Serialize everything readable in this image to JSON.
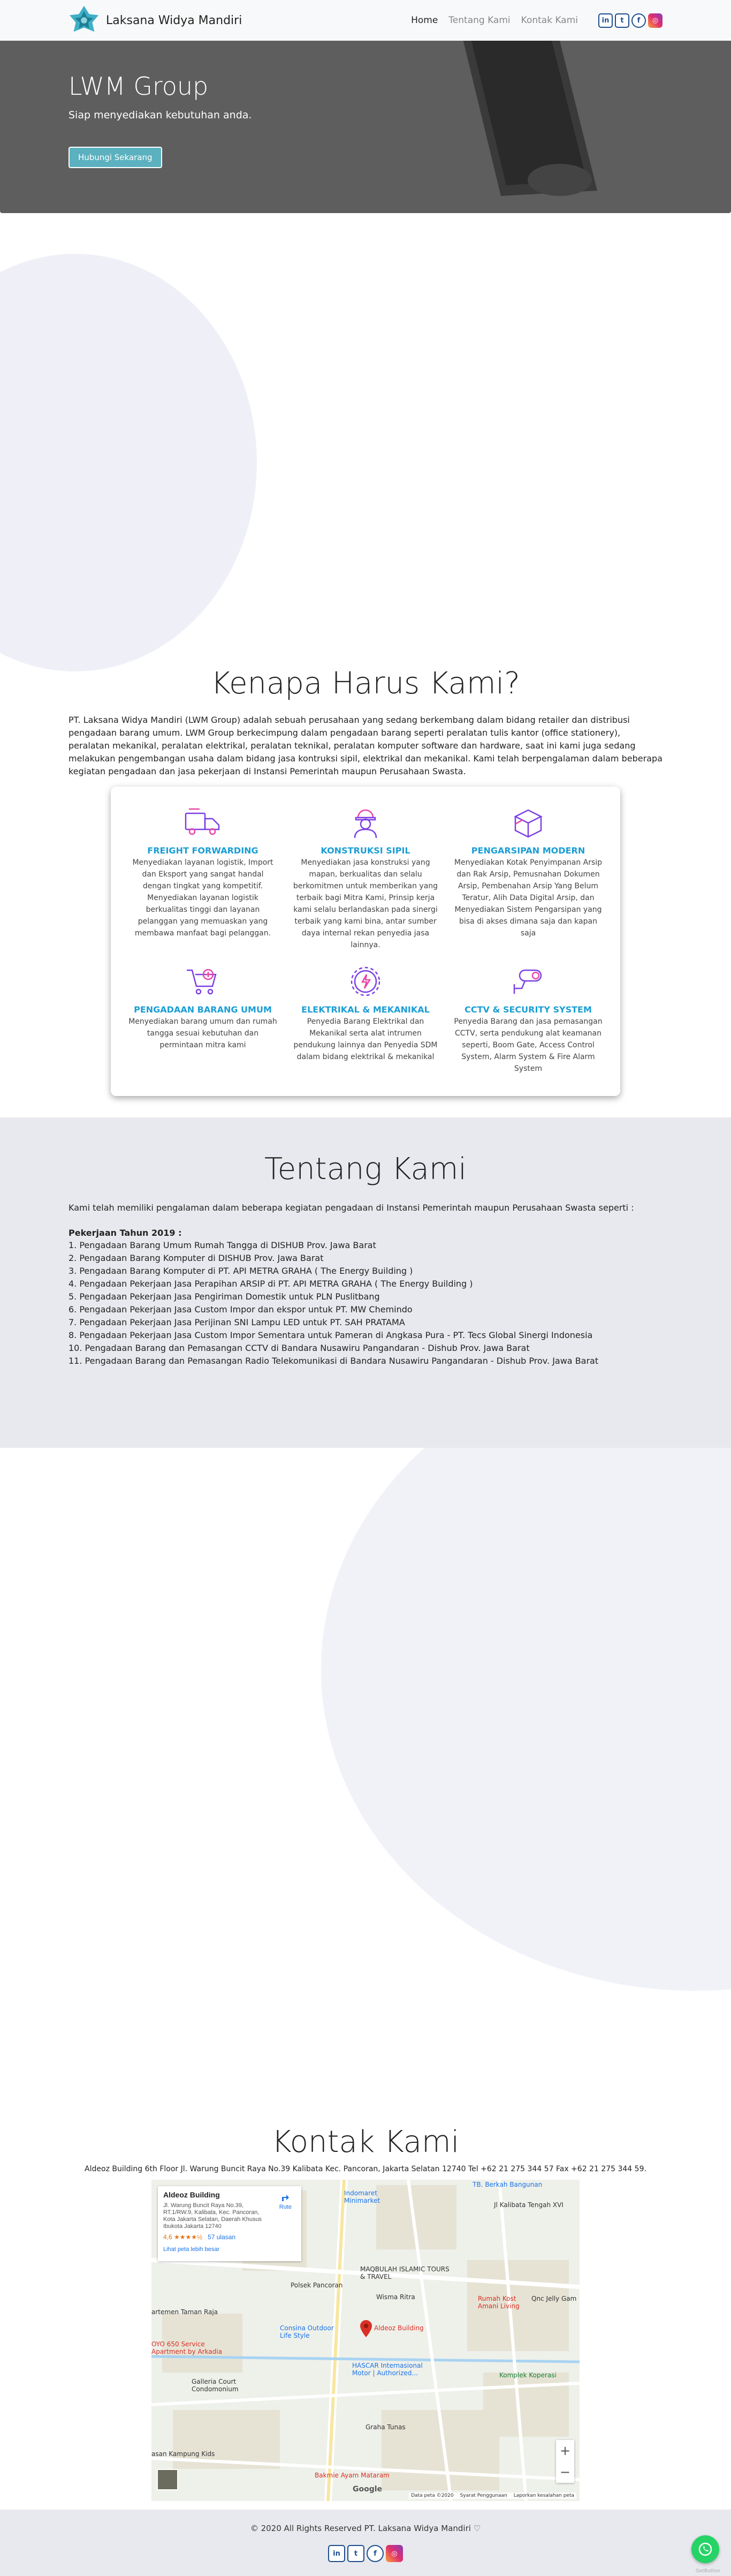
{
  "nav": {
    "brand": "Laksana Widya Mandiri",
    "links": [
      "Home",
      "Tentang Kami",
      "Kontak Kami"
    ],
    "social": [
      "linkedin-icon",
      "twitter-icon",
      "facebook-icon",
      "instagram-icon"
    ]
  },
  "hero": {
    "title": "LWM Group",
    "subtitle": "Siap menyediakan kebutuhan anda.",
    "button": "Hubungi Sekarang"
  },
  "why": {
    "title": "Kenapa Harus Kami?",
    "text": "PT. Laksana Widya Mandiri (LWM Group) adalah sebuah perusahaan yang sedang berkembang dalam bidang retailer dan distribusi pengadaan barang umum. LWM Group berkecimpung dalam pengadaan barang seperti peralatan tulis kantor (office stationery), peralatan mekanikal, peralatan elektrikal, peralatan teknikal, peralatan komputer software dan hardware, saat ini kami juga sedang melakukan pengembangan usaha dalam bidang jasa kontruksi sipil, elektrikal dan mekanikal. Kami telah berpengalaman dalam beberapa kegiatan pengadaan dan jasa pekerjaan di Instansi Pemerintah maupun Perusahaan Swasta.",
    "services": [
      {
        "title": "FREIGHT FORWARDING",
        "desc": "Menyediakan layanan logistik, Import dan Eksport yang sangat handal dengan tingkat yang kompetitif. Menyediakan layanan logistik berkualitas tinggi dan layanan pelanggan yang memuaskan yang membawa manfaat bagi pelanggan.",
        "icon": "truck-icon"
      },
      {
        "title": "KONSTRUKSI SIPIL",
        "desc": "Menyediakan jasa konstruksi yang mapan, berkualitas dan selalu berkomitmen untuk memberikan yang terbaik bagi Mitra Kami, Prinsip kerja kami selalu berlandaskan pada sinergi terbaik yang kami bina, antar sumber daya internal rekan penyedia jasa lainnya.",
        "icon": "worker-icon"
      },
      {
        "title": "PENGARSIPAN MODERN",
        "desc": "Menyediakan Kotak Penyimpanan Arsip dan Rak Arsip, Pemusnahan Dokumen Arsip, Pembenahan Arsip Yang Belum Teratur, Alih Data Digital Arsip, dan Menyediakan Sistem Pengarsipan yang bisa di akses dimana saja dan kapan saja",
        "icon": "box-icon"
      },
      {
        "title": "PENGADAAN BARANG UMUM",
        "desc": "Menyediakan barang umum dan rumah tangga sesuai kebutuhan dan permintaan mitra kami",
        "icon": "cart-icon"
      },
      {
        "title": "ELEKTRIKAL & MEKANIKAL",
        "desc": "Penyedia Barang Elektrikal dan Mekanikal serta alat intrumen pendukung lainnya dan Penyedia SDM dalam bidang elektrikal & mekanikal",
        "icon": "gear-bolt-icon"
      },
      {
        "title": "CCTV & SECURITY SYSTEM",
        "desc": "Penyedia Barang dan jasa pemasangan CCTV, serta pendukung alat keamanan seperti, Boom Gate, Access Control System, Alarm System & Fire Alarm System",
        "icon": "cctv-icon"
      }
    ]
  },
  "about": {
    "title": "Tentang Kami",
    "intro": "Kami telah memiliki pengalaman dalam beberapa kegiatan pengadaan di Instansi Pemerintah maupun Perusahaan Swasta seperti :",
    "year": "Pekerjaan Tahun 2019 :",
    "items": [
      "1. Pengadaan Barang Umum Rumah Tangga di DISHUB Prov. Jawa Barat",
      "2. Pengadaan Barang Komputer di DISHUB Prov. Jawa Barat",
      "3. Pengadaan Barang Komputer di PT. API METRA GRAHA ( The Energy Building )",
      "4. Pengadaan Pekerjaan Jasa Perapihan ARSIP di PT. API METRA GRAHA ( The Energy Building )",
      "5. Pengadaan Pekerjaan Jasa Pengiriman Domestik untuk PLN Puslitbang",
      "6. Pengadaan Pekerjaan Jasa Custom Impor dan ekspor untuk PT. MW Chemindo",
      "7. Pengadaan Pekerjaan Jasa Perijinan SNI Lampu LED untuk PT. SAH PRATAMA",
      "8. Pengadaan Pekerjaan Jasa Custom Impor Sementara untuk Pameran di Angkasa Pura - PT. Tecs Global Sinergi Indonesia",
      "10. Pengadaan Barang dan Pemasangan CCTV di Bandara Nusawiru Pangandaran - Dishub Prov. Jawa Barat",
      "11. Pengadaan Barang dan Pemasangan Radio Telekomunikasi di Bandara Nusawiru Pangandaran - Dishub Prov. Jawa Barat"
    ]
  },
  "contact": {
    "title": "Kontak Kami",
    "address": "Aldeoz Building 6th Floor Jl. Warung Buncit Raya No.39 Kalibata Kec. Pancoran, Jakarta Selatan 12740 Tel +62 21 275 344 57 Fax +62 21 275 344 59.",
    "map": {
      "place": "Aldeoz Building",
      "place_address": "Jl. Warung Buncit Raya No.39, RT.1/RW.9, Kalibata, Kec. Pancoran, Kota Jakarta Selatan, Daerah Khusus Ibukota Jakarta 12740",
      "rating": "4,6 ★★★★½",
      "reviews": "57 ulasan",
      "larger_map": "Lihat peta lebih besar",
      "route": "Rute",
      "pin_label": "Aldeoz Building",
      "footer": [
        "Data peta ©2020",
        "Syarat Penggunaan",
        "Laporkan kesalahan peta"
      ],
      "google": "Google",
      "labels": [
        {
          "text": "Indomaret Minimarket",
          "cls": "blue"
        },
        {
          "text": "TB. Berkah Bangunan",
          "cls": "blue"
        },
        {
          "text": "Jl Kalibata Tengah XVI",
          "cls": ""
        },
        {
          "text": "Polsek Pancoran",
          "cls": ""
        },
        {
          "text": "MAQBULAH ISLAMIC TOURS & TRAVEL",
          "cls": ""
        },
        {
          "text": "Wisma Ritra",
          "cls": ""
        },
        {
          "text": "Rumah Kost Amani Living",
          "cls": "red"
        },
        {
          "text": "Qnc Jelly Gam",
          "cls": ""
        },
        {
          "text": "artemen Taman Raja",
          "cls": ""
        },
        {
          "text": "Consina Outdoor Life Style",
          "cls": "blue"
        },
        {
          "text": "OYO 650 Service Apartment by Arkadia",
          "cls": "red"
        },
        {
          "text": "Galleria Court Condomonium",
          "cls": ""
        },
        {
          "text": "HASCAR Internasional Motor | Authorized...",
          "cls": "blue"
        },
        {
          "text": "Komplek Koperasi",
          "cls": "green"
        },
        {
          "text": "Graha Tunas",
          "cls": ""
        },
        {
          "text": "asan Kampung Kids",
          "cls": ""
        },
        {
          "text": "Bakmie Ayam Mataram",
          "cls": "red"
        }
      ]
    }
  },
  "footer": {
    "copyright": "© 2020 All Rights Reserved PT. Laksana Widya Mandiri",
    "whatsapp_label": "GetButton"
  },
  "colors": {
    "accent": "#1a9ed6",
    "button": "#5bb1bf",
    "icon_purple": "#7b3fe4"
  }
}
